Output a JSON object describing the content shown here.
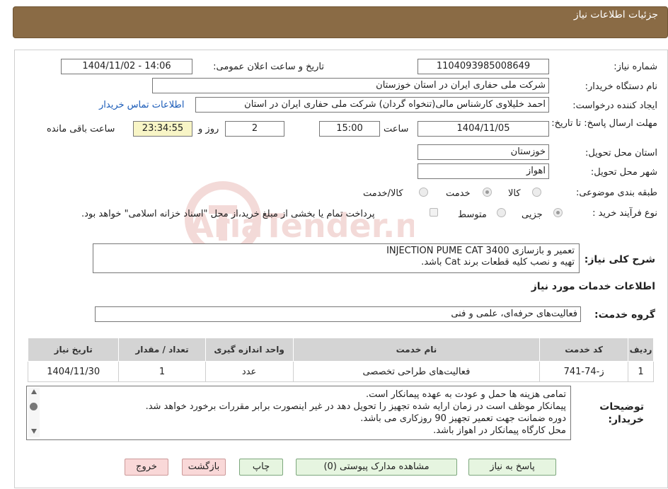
{
  "header": {
    "title": "جزئیات اطلاعات نیاز"
  },
  "watermark": {
    "text": "AriaTender.neT"
  },
  "form": {
    "need_number": {
      "label": "شماره نیاز:",
      "value": "1104093985008649"
    },
    "announce": {
      "label": "تاریخ و ساعت اعلان عمومی:",
      "value": "1404/11/02 - 14:06"
    },
    "buyer": {
      "label": "نام دستگاه خریدار:",
      "value": "شرکت ملی حفاری ایران در استان خوزستان"
    },
    "creator": {
      "label": "ایجاد کننده درخواست:",
      "value": "احمد خلیلاوی کارشناس مالی(تنخواه گردان) شرکت ملی حفاری ایران در استان",
      "contact_link": "اطلاعات تماس خریدار"
    },
    "deadline": {
      "label": "مهلت ارسال پاسخ: تا تاریخ:",
      "date": "1404/11/05",
      "time_label": "ساعت",
      "time": "15:00",
      "days": "2",
      "days_label": "روز و",
      "remaining": "23:34:55",
      "remaining_label": "ساعت باقی مانده"
    },
    "province": {
      "label": "استان محل تحویل:",
      "value": "خوزستان"
    },
    "city": {
      "label": "شهر محل تحویل:",
      "value": "اهواز"
    },
    "category": {
      "label": "طبقه بندی موضوعی:",
      "options": [
        "کالا",
        "خدمت",
        "کالا/خدمت"
      ],
      "selected": "خدمت"
    },
    "process": {
      "label": "نوع فرآیند خرید :",
      "options": [
        "جزیی",
        "متوسط"
      ],
      "selected": "جزیی",
      "treasury_note": "پرداخت تمام یا بخشی از مبلغ خرید،از محل \"اسناد خزانه اسلامی\" خواهد بود."
    },
    "summary": {
      "label": "شرح کلی نیاز:",
      "line1": "تعمیر و بازسازی INJECTION PUME CAT 3400",
      "line2": "تهیه و نصب کلیه قطعات برند Cat باشد."
    },
    "services_title": "اطلاعات خدمات مورد نیاز",
    "service_group": {
      "label": "گروه خدمت:",
      "value": "فعالیت‌های حرفه‌ای، علمی و فنی"
    }
  },
  "table": {
    "headers": [
      "ردیف",
      "کد خدمت",
      "نام خدمت",
      "واحد اندازه گیری",
      "تعداد / مقدار",
      "تاریخ نیاز"
    ],
    "rows": [
      [
        "1",
        "ز-74-741",
        "فعالیت‌های طراحی تخصصی",
        "عدد",
        "1",
        "1404/11/30"
      ]
    ]
  },
  "notes": {
    "label": "توضیحات خریدار:",
    "lines": [
      "تمامی هزینه ها حمل و عودت به عهده پیمانکار است.",
      "پیمانکار موظف است در زمان ارایه شده تجهیز را تحویل دهد در غیر اینصورت برابر مقررات برخورد خواهد شد.",
      "دوره ضمانت جهت تعمیر تجهیز  90 روزکاری می باشد.",
      "محل کارگاه پیمانکار در اهواز باشد."
    ]
  },
  "buttons": {
    "reply": "پاسخ به نیاز",
    "attachments": "مشاهده مدارک پیوستی (0)",
    "print": "چاپ",
    "back": "بازگشت",
    "exit": "خروج"
  },
  "colors": {
    "header_bg": "#8a6b45",
    "link": "#1a5bb8",
    "button_green": "#e6f5e0",
    "button_pink": "#f9d8d8",
    "timer_bg": "#f8f5c6"
  }
}
